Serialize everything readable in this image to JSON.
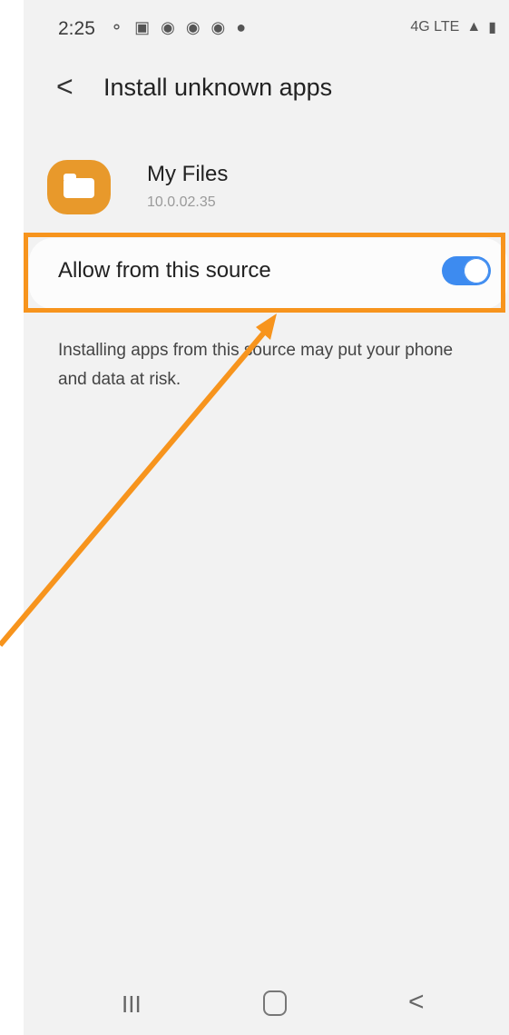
{
  "status": {
    "time": "2:25",
    "icons": [
      "wifi-calling-icon",
      "gallery-icon",
      "lock-icon",
      "lock-icon",
      "lock-icon",
      "shield-icon"
    ],
    "network": "4G LTE"
  },
  "header": {
    "back_label": "<",
    "title": "Install unknown apps"
  },
  "app": {
    "name": "My Files",
    "version": "10.0.02.35"
  },
  "setting": {
    "label": "Allow from this source",
    "enabled": true
  },
  "warning": {
    "text": "Installing apps from this source may put your phone and data at risk."
  },
  "navbar": {
    "recents_label": "III",
    "back_label": "<"
  },
  "colors": {
    "background": "#f2f2f2",
    "toggle_on": "#3d8bf0",
    "highlight": "#f7941d",
    "app_icon": "#e8992b"
  }
}
